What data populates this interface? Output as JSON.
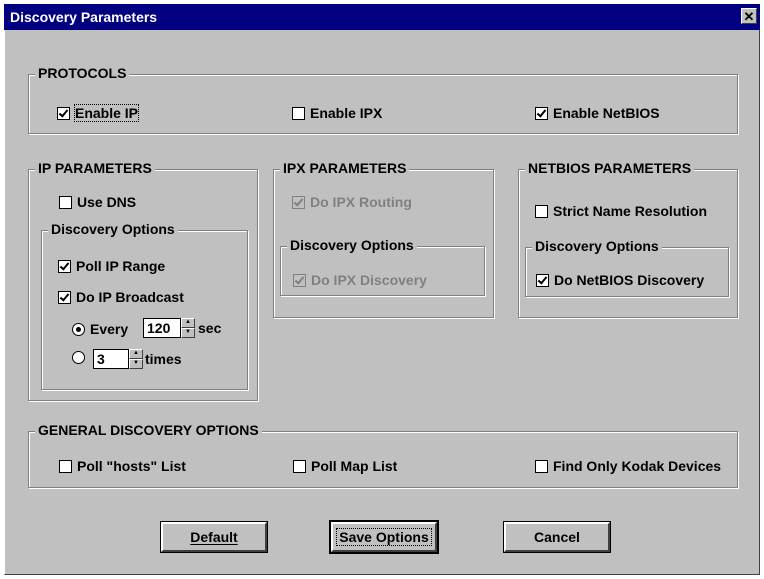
{
  "window": {
    "title": "Discovery Parameters",
    "close_glyph": "✕"
  },
  "protocols": {
    "legend": "PROTOCOLS",
    "enable_ip": {
      "label": "Enable IP",
      "checked": true
    },
    "enable_ipx": {
      "label": "Enable IPX",
      "checked": false
    },
    "enable_netbios": {
      "label": "Enable NetBIOS",
      "checked": true
    }
  },
  "ip_params": {
    "legend": "IP PARAMETERS",
    "use_dns": {
      "label": "Use DNS",
      "checked": false
    },
    "discovery_options": {
      "legend": "Discovery Options",
      "poll_ip_range": {
        "label": "Poll IP Range",
        "checked": true
      },
      "do_ip_broadcast": {
        "label": "Do IP Broadcast",
        "checked": true
      },
      "every": {
        "label": "Every",
        "selected": true,
        "value": "120",
        "unit": "sec"
      },
      "times": {
        "selected": false,
        "value": "3",
        "unit": "times"
      }
    }
  },
  "ipx_params": {
    "legend": "IPX PARAMETERS",
    "do_ipx_routing": {
      "label": "Do IPX Routing",
      "checked": true,
      "disabled": true
    },
    "discovery_options": {
      "legend": "Discovery Options",
      "do_ipx_discovery": {
        "label": "Do IPX Discovery",
        "checked": true,
        "disabled": true
      }
    }
  },
  "netbios_params": {
    "legend": "NETBIOS PARAMETERS",
    "strict_name_resolution": {
      "label": "Strict Name Resolution",
      "checked": false
    },
    "discovery_options": {
      "legend": "Discovery Options",
      "do_netbios_discovery": {
        "label": "Do NetBIOS Discovery",
        "checked": true
      }
    }
  },
  "general": {
    "legend": "GENERAL DISCOVERY OPTIONS",
    "poll_hosts_list": {
      "label": "Poll \"hosts\" List",
      "checked": false
    },
    "poll_map_list": {
      "label": "Poll Map List",
      "checked": false
    },
    "find_only_kodak": {
      "label": "Find Only Kodak Devices",
      "checked": false
    }
  },
  "buttons": {
    "default": "Default",
    "save_options": "Save Options",
    "cancel": "Cancel"
  },
  "colors": {
    "face": "#c0c0c0",
    "title_bar": "#000080",
    "shadow": "#808080",
    "disabled_text": "#808080"
  }
}
